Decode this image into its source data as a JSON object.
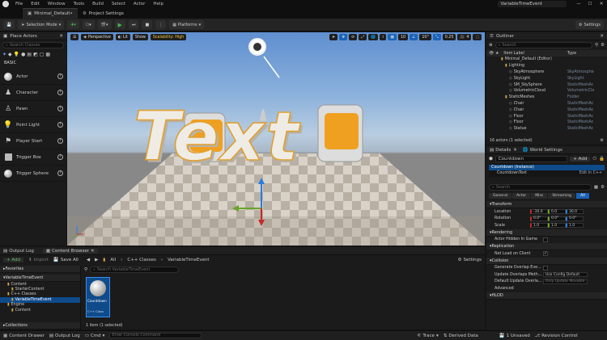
{
  "menu": [
    "File",
    "Edit",
    "Window",
    "Tools",
    "Build",
    "Select",
    "Actor",
    "Help"
  ],
  "project_name": "VariableTimeEvent",
  "tabs": [
    {
      "label": "Minimal_Default•"
    },
    {
      "label": "Project Settings"
    }
  ],
  "toolbar": {
    "selection_mode": "Selection Mode",
    "platforms": "Platforms",
    "settings": "Settings"
  },
  "place_actors": {
    "title": "Place Actors",
    "search_placeholder": "Search Classes",
    "category": "BASIC",
    "items": [
      {
        "label": "Actor",
        "icon": "actor-icon"
      },
      {
        "label": "Character",
        "icon": "character-icon"
      },
      {
        "label": "Pawn",
        "icon": "pawn-icon"
      },
      {
        "label": "Point Light",
        "icon": "point-light-icon"
      },
      {
        "label": "Player Start",
        "icon": "player-start-icon"
      },
      {
        "label": "Trigger Box",
        "icon": "trigger-box-icon"
      },
      {
        "label": "Trigger Sphere",
        "icon": "trigger-sphere-icon"
      }
    ]
  },
  "viewport": {
    "perspective": "Perspective",
    "lit": "Lit",
    "show": "Show",
    "scalability": "Scalability: High",
    "grid": "10",
    "rot": "10°",
    "scale": "0.25",
    "cam": "4",
    "text_actor": "Text"
  },
  "outliner": {
    "title": "Outliner",
    "search_placeholder": "Search",
    "col_label": "Item Label",
    "col_type": "Type",
    "rows": [
      {
        "label": "Minimal_Default (Editor)",
        "type": "",
        "indent": 1
      },
      {
        "label": "Lighting",
        "type": "",
        "indent": 2
      },
      {
        "label": "SkyAtmosphere",
        "type": "SkyAtmosphe",
        "indent": 3
      },
      {
        "label": "SkyLight",
        "type": "SkyLight",
        "indent": 3
      },
      {
        "label": "SM_SkySphere",
        "type": "StaticMeshAc",
        "indent": 3
      },
      {
        "label": "VolumetricCloud",
        "type": "VolumetricClo",
        "indent": 3
      },
      {
        "label": "StaticMeshes",
        "type": "Folder",
        "indent": 2
      },
      {
        "label": "Chair",
        "type": "StaticMeshAc",
        "indent": 3
      },
      {
        "label": "Chair",
        "type": "StaticMeshAc",
        "indent": 3
      },
      {
        "label": "Floor",
        "type": "StaticMeshAc",
        "indent": 3
      },
      {
        "label": "Floor",
        "type": "StaticMeshAc",
        "indent": 3
      },
      {
        "label": "Statue",
        "type": "StaticMeshAc",
        "indent": 3
      }
    ],
    "footer": "16 actors (1 selected)"
  },
  "details": {
    "tab_details": "Details",
    "tab_world": "World Settings",
    "actor_name": "Countdown",
    "add": "+ Add",
    "component_root": "Countdown (Instance)",
    "component_child": "CountdownText",
    "edit_cpp": "Edit in C++",
    "search_placeholder": "Search",
    "filters": [
      "General",
      "Actor",
      "Misc",
      "Streaming",
      "All"
    ],
    "transform": "Transform",
    "location_label": "Location",
    "location": [
      "-30.0",
      "0.0",
      "30.0"
    ],
    "rotation_label": "Rotation",
    "rotation": [
      "0.0°",
      "0.0°",
      "0.0°"
    ],
    "scale_label": "Scale",
    "scale": [
      "1.0",
      "1.0",
      "1.0"
    ],
    "rendering": "Rendering",
    "hidden_in_game": "Actor Hidden In Game",
    "replication": "Replication",
    "net_load": "Net Load on Client",
    "collision": "Collision",
    "gen_overlap": "Generate Overlap Eve...",
    "update_overlap": "Update Overlaps Meth...",
    "update_overlap_val": "Use Config Default",
    "default_overlap": "Default Update Overla...",
    "default_overlap_val": "Only Update Movable",
    "advanced": "Advanced",
    "hlod": "HLOD"
  },
  "bottom": {
    "tab_output": "Output Log",
    "tab_content": "Content Browser",
    "add": "+ Add",
    "import": "Import",
    "save_all": "Save All",
    "path": [
      "All",
      "C++ Classes",
      "VariableTimeEvent"
    ],
    "settings": "Settings",
    "favorites": "Favorites",
    "project_root": "VariableTimeEvent",
    "tree": [
      {
        "label": "Content",
        "indent": 1
      },
      {
        "label": "StarterContent",
        "indent": 2
      },
      {
        "label": "C++ Classes",
        "indent": 1
      },
      {
        "label": "VariableTimeEvent",
        "indent": 2,
        "selected": true
      },
      {
        "label": "Engine",
        "indent": 1
      },
      {
        "label": "Content",
        "indent": 2
      }
    ],
    "collections": "Collections",
    "search_placeholder": "Search VariableTimeEvent",
    "asset_name": "Countdown",
    "asset_type": "C++ Class",
    "items_count": "1 item (1 selected)"
  },
  "status": {
    "content_drawer": "Content Drawer",
    "output_log": "Output Log",
    "cmd": "Cmd",
    "cmd_placeholder": "Enter Console Command",
    "trace": "Trace",
    "derived": "Derived Data",
    "unsaved": "1 Unsaved",
    "revision": "Revision Control"
  }
}
